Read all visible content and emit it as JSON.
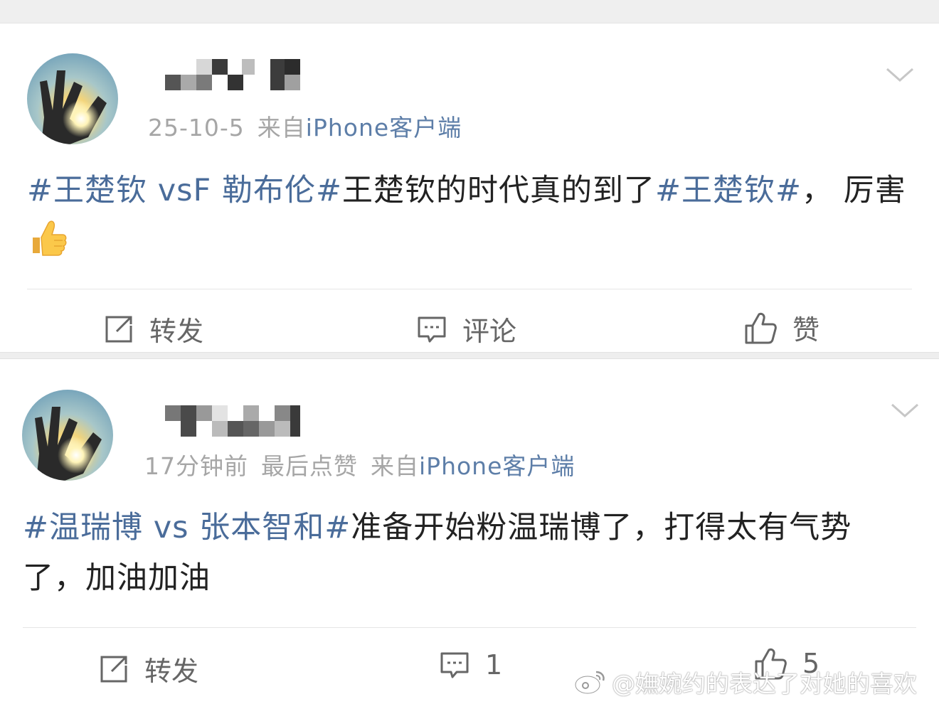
{
  "posts": [
    {
      "meta_time": "25-10-5",
      "meta_from": "来自",
      "meta_device": "iPhone",
      "meta_client": "客户端",
      "content": {
        "tag1": "#王楚钦 vsF 勒布伦#",
        "text1": "王楚钦的时代真的到了",
        "tag2": "#王楚钦#",
        "text2": "，  厉害"
      },
      "emoji": "thumbs-up-emoji",
      "actions": {
        "repost": "转发",
        "comment": "评论",
        "like": "赞"
      }
    },
    {
      "meta_time": "17分钟前",
      "meta_extra": "最后点赞",
      "meta_from": "来自",
      "meta_device": "iPhone",
      "meta_client": "客户端",
      "content": {
        "tag1": "#温瑞博 vs 张本智和#",
        "text1": "准备开始粉温瑞博了，打得太有气势了，加油加油"
      },
      "actions": {
        "repost": "转发",
        "comment": "1",
        "like": "5"
      }
    }
  ],
  "watermark": "@嫵婉约的表达了对她的喜欢",
  "icons": {
    "repost": "repost-icon",
    "comment": "comment-icon",
    "like": "like-icon",
    "chevron": "chevron-down-icon",
    "weibo": "weibo-logo-icon"
  },
  "colors": {
    "topic_link": "#4a6c9a",
    "meta": "#a6a6a6",
    "client_link": "#5d7ea8"
  }
}
